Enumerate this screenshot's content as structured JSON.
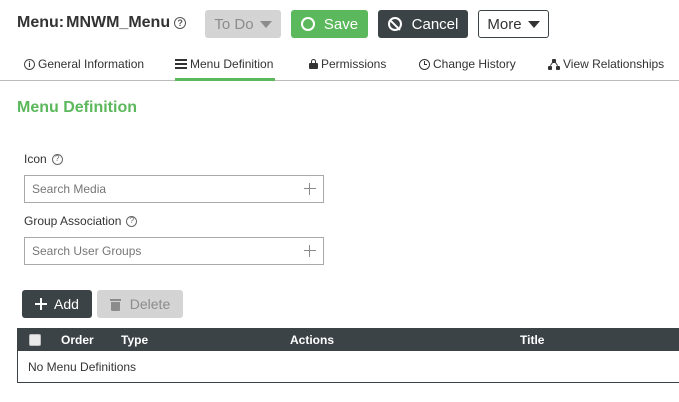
{
  "header": {
    "title_label": "Menu:",
    "title_value": "MNWM_Menu",
    "help_glyph": "?",
    "todo_label": "To Do",
    "save_label": "Save",
    "cancel_label": "Cancel",
    "more_label": "More"
  },
  "tabs": [
    {
      "label": "General Information",
      "icon": "info-icon",
      "active": false
    },
    {
      "label": "Menu Definition",
      "icon": "list-icon",
      "active": true
    },
    {
      "label": "Permissions",
      "icon": "lock-icon",
      "active": false
    },
    {
      "label": "Change History",
      "icon": "clock-icon",
      "active": false
    },
    {
      "label": "View Relationships",
      "icon": "hierarchy-icon",
      "active": false
    }
  ],
  "section": {
    "title": "Menu Definition",
    "icon_label": "Icon",
    "icon_placeholder": "Search Media",
    "icon_value": "",
    "group_label": "Group Association",
    "group_placeholder": "Search User Groups",
    "group_value": ""
  },
  "actions": {
    "add_label": "Add",
    "delete_label": "Delete"
  },
  "table": {
    "columns": [
      "Order",
      "Type",
      "Actions",
      "Title"
    ],
    "empty_text": "No Menu Definitions",
    "rows": []
  },
  "colors": {
    "accent": "#5cb85c",
    "dark": "#3c4346",
    "disabled": "#d4d4d4"
  }
}
